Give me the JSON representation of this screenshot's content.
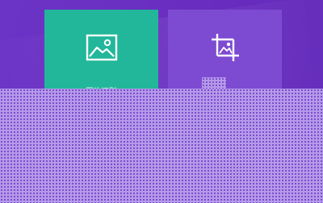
{
  "tiles": [
    {
      "label": "图片识别",
      "icon": "image-icon",
      "color": "#22b79a"
    },
    {
      "label": "",
      "icon": "crop-icon",
      "color": "#7d4bd1"
    }
  ],
  "colors": {
    "background": "#6a31c4",
    "noise_overlay": "#b59ae9"
  }
}
